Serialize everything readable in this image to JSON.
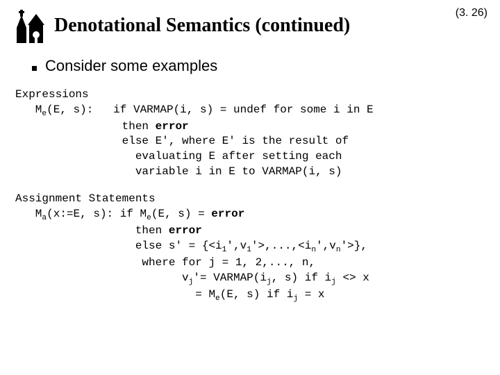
{
  "page_number": "(3. 26)",
  "title": "Denotational Semantics (continued)",
  "bullet": "Consider some examples",
  "expr": {
    "heading": "Expressions",
    "sig_lhs": "(E, s):",
    "l1a": "if VARMAP(i, s) = undef for some i in E",
    "l2a": "then ",
    "l2b": "error",
    "l3": "else E', where E' is the result of",
    "l4": "  evaluating E after setting each",
    "l5": "  variable i in E to VARMAP(i, s)"
  },
  "assign": {
    "heading": "Assignment Statements",
    "sig_lhs": "(x:=E, s): if M",
    "sig_rhs": "(E, s) = ",
    "err": "error",
    "l2a": "then ",
    "l3a": "else s' = {<i",
    "l3b": "',v",
    "l3c": "'>,...,<i",
    "l3d": "',v",
    "l3e": "'>},",
    "l4": " where for j = 1, 2,..., n,",
    "l5a": "       v",
    "l5b": "'= VARMAP(i",
    "l5c": ", s) if i",
    "l5d": " <> x",
    "l6a": "         = M",
    "l6b": "(E, s) if i",
    "l6c": " = x"
  }
}
